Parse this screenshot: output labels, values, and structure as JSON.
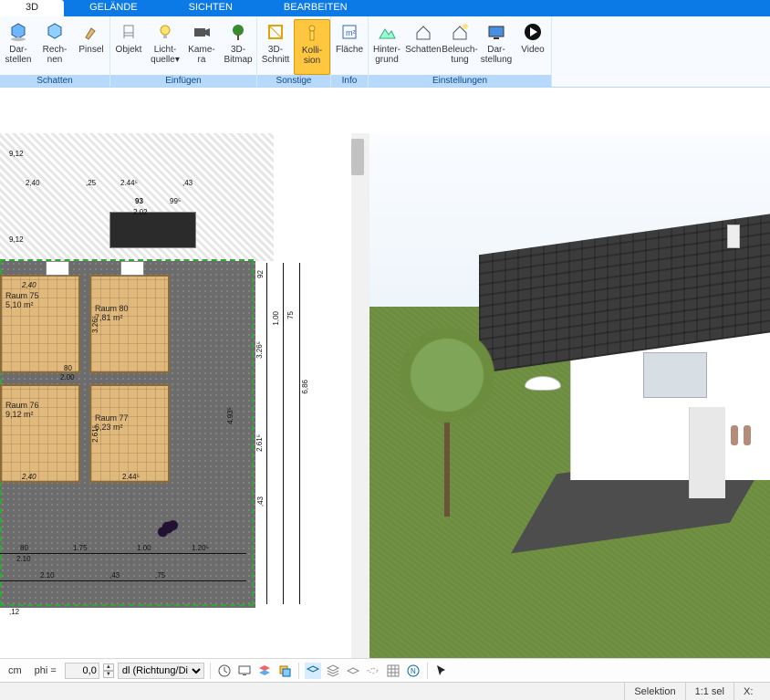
{
  "tabs": {
    "t0": "3D",
    "t1": "GELÄNDE",
    "t2": "SICHTEN",
    "t3": "BEARBEITEN"
  },
  "ribbon": {
    "g0": {
      "label": "Schatten",
      "b0": "Dar-\nstellen",
      "b1": "Rech-\nnen",
      "b2": "Pinsel"
    },
    "g1": {
      "label": "Einfügen",
      "b0": "Objekt",
      "b1": "Licht-\nquelle▾",
      "b2": "Kame-\nra",
      "b3": "3D-\nBitmap"
    },
    "g2": {
      "label": "Sonstige",
      "b0": "3D-\nSchnitt",
      "b1": "Kolli-\nsion"
    },
    "g3": {
      "label": "Info",
      "b0": "Fläche"
    },
    "g4": {
      "label": "Einstellungen",
      "b0": "Hinter-\ngrund",
      "b1": "Schatten",
      "b2": "Beleuch-\ntung",
      "b3": "Dar-\nstellung",
      "b4": "Video"
    }
  },
  "plan": {
    "top_w": "9,12",
    "d_240": "2,40",
    "d_25": ",25",
    "d_2445": "2.44⁵",
    "d_43": ",43",
    "d_93": "93",
    "d_995": "99⁵",
    "d_202": "2.02",
    "d_912b": "9,12",
    "r75": "Raum 75\n5,10 m²",
    "r76": "Raum 76\n9,12 m²",
    "r77": "Raum 77\n6,23 m²",
    "r80": "Raum 80\n7,81 m²",
    "w240a": "2,40",
    "w240b": "2,40",
    "h326": "3.26⁵",
    "h261": "2.61⁵",
    "h493": "4.93⁵",
    "h686": "6,86",
    "h75": "75",
    "h100": "1,00",
    "d_80": "80",
    "d_200": "2.00",
    "w2445b": "2.44⁵",
    "b_80": "80",
    "b_210": "2.10",
    "b_175": "1.75",
    "b_100": "1.00",
    "b_1205": "1.20⁵",
    "b2_210": "2.10",
    "b2_43": ",43",
    "b2_75": ",75",
    "b2_12": ",12",
    "h92": "92",
    "h43r": ",43"
  },
  "toolbar": {
    "cm": "cm",
    "phi": "phi =",
    "phi_val": "0,0",
    "mode": "dl (Richtung/Di"
  },
  "status": {
    "sel": "Selektion",
    "scale": "1:1 sel",
    "x": "X:"
  }
}
